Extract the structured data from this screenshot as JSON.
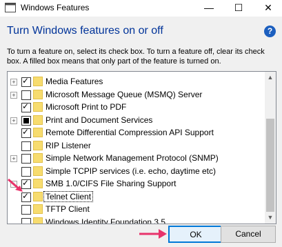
{
  "window": {
    "title": "Windows Features",
    "minimize": "—",
    "maximize": "☐",
    "close": "✕"
  },
  "heading": "Turn Windows features on or off",
  "help": "?",
  "description": "To turn a feature on, select its check box. To turn a feature off, clear its check box. A filled box means that only part of the feature is turned on.",
  "features": [
    {
      "label": "Media Features",
      "expandable": true,
      "state": "checked"
    },
    {
      "label": "Microsoft Message Queue (MSMQ) Server",
      "expandable": true,
      "state": "unchecked"
    },
    {
      "label": "Microsoft Print to PDF",
      "expandable": false,
      "state": "checked"
    },
    {
      "label": "Print and Document Services",
      "expandable": true,
      "state": "partial"
    },
    {
      "label": "Remote Differential Compression API Support",
      "expandable": false,
      "state": "checked"
    },
    {
      "label": "RIP Listener",
      "expandable": false,
      "state": "unchecked"
    },
    {
      "label": "Simple Network Management Protocol (SNMP)",
      "expandable": true,
      "state": "unchecked"
    },
    {
      "label": "Simple TCPIP services (i.e. echo, daytime etc)",
      "expandable": false,
      "state": "unchecked"
    },
    {
      "label": "SMB 1.0/CIFS File Sharing Support",
      "expandable": true,
      "state": "checked"
    },
    {
      "label": "Telnet Client",
      "expandable": false,
      "state": "checked",
      "selected": true
    },
    {
      "label": "TFTP Client",
      "expandable": false,
      "state": "unchecked"
    },
    {
      "label": "Windows Identity Foundation 3.5",
      "expandable": false,
      "state": "unchecked"
    }
  ],
  "buttons": {
    "ok": "OK",
    "cancel": "Cancel"
  },
  "colors": {
    "heading": "#003399",
    "accent": "#0078d7",
    "annotation_arrow": "#e8336b"
  }
}
